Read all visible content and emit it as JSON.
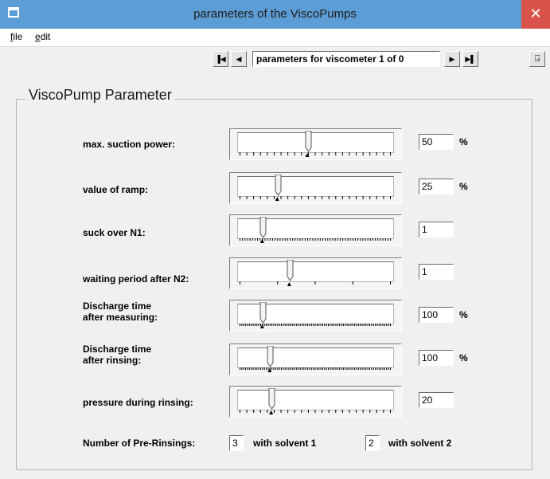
{
  "window": {
    "title": "parameters of the ViscoPumps",
    "close_glyph": "✕"
  },
  "menu": [
    {
      "label": "file",
      "accel": "f",
      "rest": "ile"
    },
    {
      "label": "edit",
      "accel": "e",
      "rest": "dit"
    }
  ],
  "nav": {
    "first_icon": "first-record-icon",
    "prev_icon": "previous-record-icon",
    "next_icon": "next-record-icon",
    "last_icon": "last-record-icon",
    "first_glyph": "▐◀",
    "prev_glyph": "◀",
    "next_glyph": "▶",
    "last_glyph": "▶▌",
    "record_text": "parameters for viscometer 1 of 0",
    "exit_icon": "exit-door-icon",
    "exit_glyph": "⍈"
  },
  "group": {
    "title": "ViscoPump Parameter"
  },
  "parameters": [
    {
      "label": "max. suction power:",
      "value": "50",
      "unit": "%",
      "position": 0.45,
      "ticks": 23
    },
    {
      "label": "value of ramp:",
      "value": "25",
      "unit": "%",
      "position": 0.25,
      "ticks": 23
    },
    {
      "label": "suck over N1:",
      "value": "1",
      "unit": "",
      "position": 0.15,
      "ticks": 61
    },
    {
      "label": "waiting period after N2:",
      "value": "1",
      "unit": "",
      "position": 0.33,
      "ticks": 5
    },
    {
      "label_line1": "Discharge time",
      "label_line2": "after measuring:",
      "value": "100",
      "unit": "%",
      "position": 0.15,
      "ticks": 81
    },
    {
      "label_line1": "Discharge time",
      "label_line2": "after rinsing:",
      "value": "100",
      "unit": "%",
      "position": 0.2,
      "ticks": 81
    },
    {
      "label": "pressure during rinsing:",
      "value": "20",
      "unit": "",
      "position": 0.21,
      "ticks": 23
    }
  ],
  "prerinsing": {
    "label": "Number of Pre-Rinsings:",
    "solvent1_value": "3",
    "solvent1_label": "with solvent 1",
    "solvent2_value": "2",
    "solvent2_label": "with solvent 2"
  }
}
